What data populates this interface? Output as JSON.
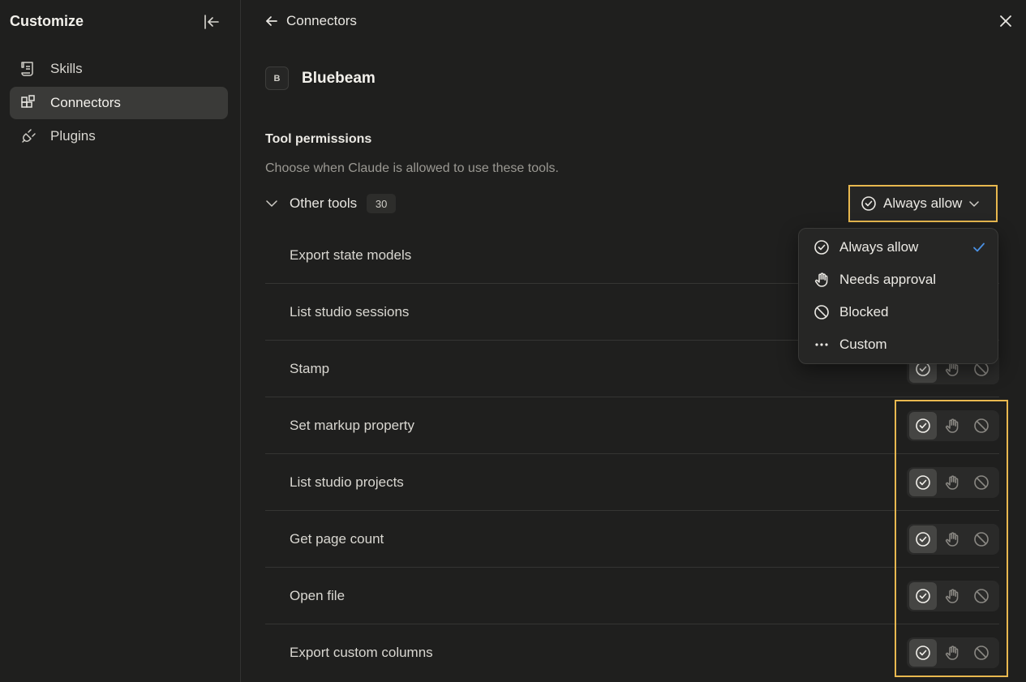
{
  "sidebar": {
    "title": "Customize",
    "items": [
      {
        "label": "Skills",
        "icon": "scroll-icon"
      },
      {
        "label": "Connectors",
        "icon": "blocks-icon",
        "active": true
      },
      {
        "label": "Plugins",
        "icon": "plug-icon"
      }
    ]
  },
  "main": {
    "back_label": "Connectors",
    "connector": {
      "badge": "B",
      "name": "Bluebeam"
    },
    "permissions": {
      "title": "Tool permissions",
      "subtitle": "Choose when Claude is allowed to use these tools."
    },
    "group": {
      "label": "Other tools",
      "count": "30",
      "selected": "Always allow"
    },
    "tools": [
      {
        "name": "Export state models",
        "permission": "always-allow"
      },
      {
        "name": "List studio sessions",
        "permission": "always-allow"
      },
      {
        "name": "Stamp",
        "permission": "always-allow"
      },
      {
        "name": "Set markup property",
        "permission": "always-allow"
      },
      {
        "name": "List studio projects",
        "permission": "always-allow"
      },
      {
        "name": "Get page count",
        "permission": "always-allow"
      },
      {
        "name": "Open file",
        "permission": "always-allow"
      },
      {
        "name": "Export custom columns",
        "permission": "always-allow"
      }
    ],
    "menu": {
      "options": [
        {
          "label": "Always allow",
          "icon": "check-circle-icon",
          "selected": true
        },
        {
          "label": "Needs approval",
          "icon": "hand-icon"
        },
        {
          "label": "Blocked",
          "icon": "blocked-icon"
        },
        {
          "label": "Custom",
          "icon": "ellipsis-icon"
        }
      ]
    }
  },
  "colors": {
    "background": "#1f1f1e",
    "highlight": "#e8b84f",
    "check_accent": "#4a90e2"
  }
}
